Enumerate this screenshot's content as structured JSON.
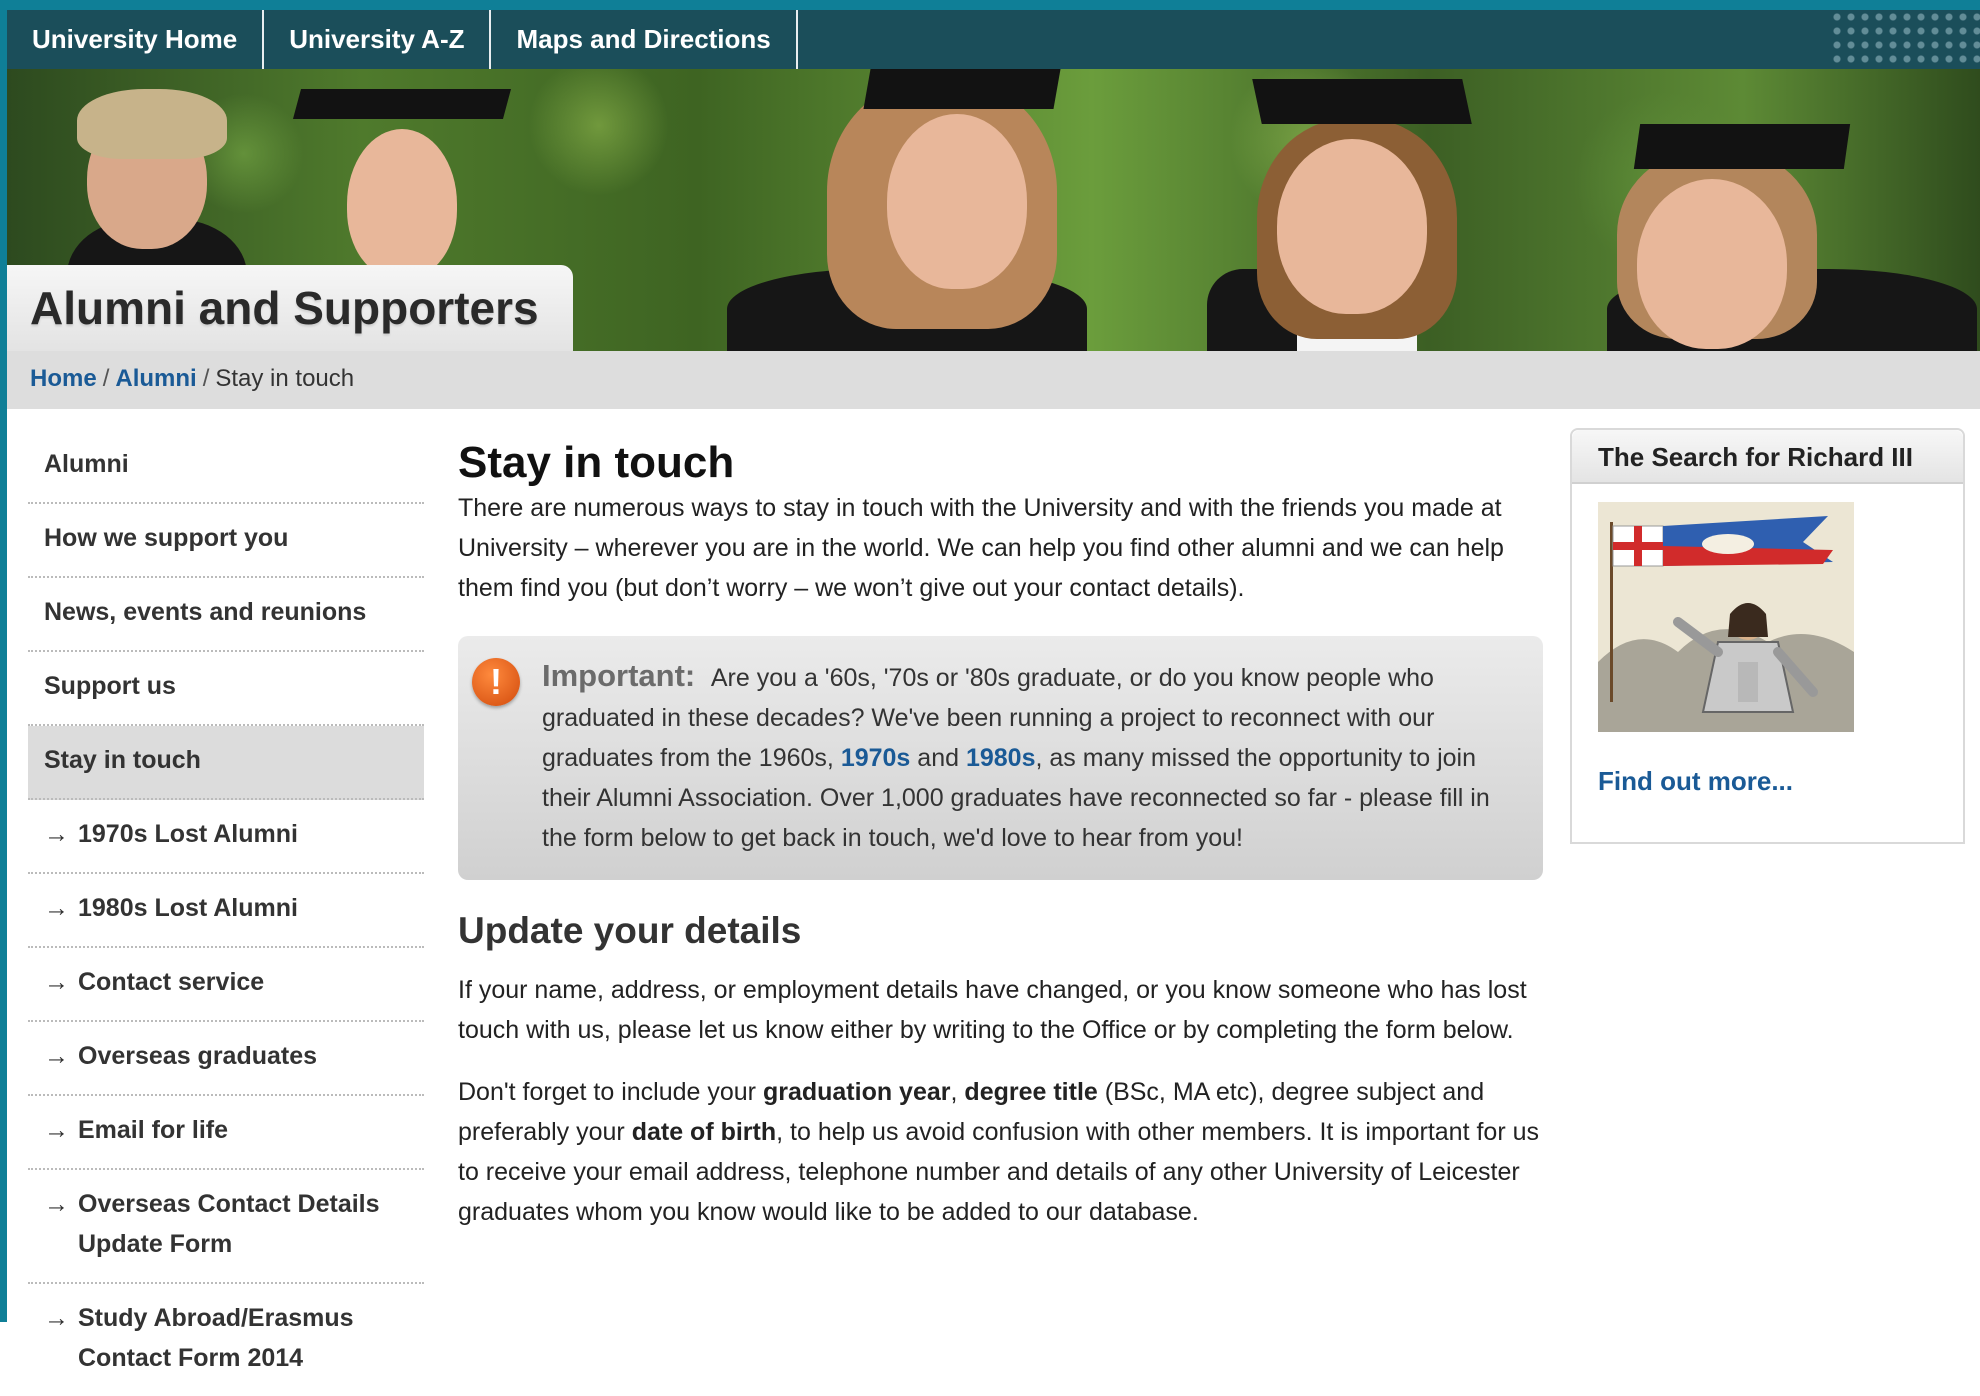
{
  "top_nav": {
    "items": [
      "University Home",
      "University A-Z",
      "Maps and Directions"
    ]
  },
  "header": {
    "title": "Alumni and Supporters"
  },
  "breadcrumb": {
    "items": [
      "Home",
      "Alumni",
      "Stay in touch"
    ],
    "separator": "/"
  },
  "sidebar": {
    "arrow": "→",
    "items": [
      {
        "label": "Alumni"
      },
      {
        "label": "How we support you"
      },
      {
        "label": "News, events and reunions"
      },
      {
        "label": "Support us"
      },
      {
        "label": "Stay in touch"
      },
      {
        "label": "1970s Lost Alumni"
      },
      {
        "label": "1980s Lost Alumni"
      },
      {
        "label": "Contact service"
      },
      {
        "label": "Overseas graduates"
      },
      {
        "label": "Email for life"
      },
      {
        "label": "Overseas Contact Details Update Form"
      },
      {
        "label": "Study Abroad/Erasmus Contact Form 2014"
      }
    ]
  },
  "main": {
    "title": "Stay in touch",
    "intro": "There are numerous ways to stay in touch with the University and with the friends you made at University – wherever you are in the world. We can help you find other alumni and we can help them find you (but don’t worry – we won’t give out your contact details).",
    "important": {
      "icon_glyph": "!",
      "label": "Important:",
      "text_before": "Are you a '60s, '70s or '80s graduate, or do you know people who graduated in these decades? We've been running a project to reconnect with our graduates from the 1960s,",
      "link_1970s": "1970s",
      "and": "and",
      "link_1980s": "1980s",
      "text_after": ", as many missed the opportunity to join their Alumni Association. Over 1,000 graduates have reconnected so far - please fill in the form below to get back in touch, we'd love to hear from you!"
    },
    "update_heading": "Update your details",
    "update_para": "If your name, address, or employment details have changed, or you know someone who has lost touch with us, please let us know either by writing to the Office or by completing the form below.",
    "reminder": {
      "t1": "Don't forget to include your",
      "b1": "graduation year",
      "t2": ",",
      "b2": "degree title",
      "t3": "(BSc, MA etc), degree subject and preferably your",
      "b3": "date of birth",
      "t4": ", to help us avoid confusion with other members. It is important for us to receive your email address, telephone number and details of any other University of Leicester graduates whom you know would like to be added to our database."
    }
  },
  "promo": {
    "title": "The Search for Richard III",
    "link": "Find out more..."
  },
  "colors": {
    "teal": "#0f7f97",
    "nav_bg": "#1b4e5a",
    "link": "#1a5a96",
    "alert_orange": "#e0600f"
  }
}
